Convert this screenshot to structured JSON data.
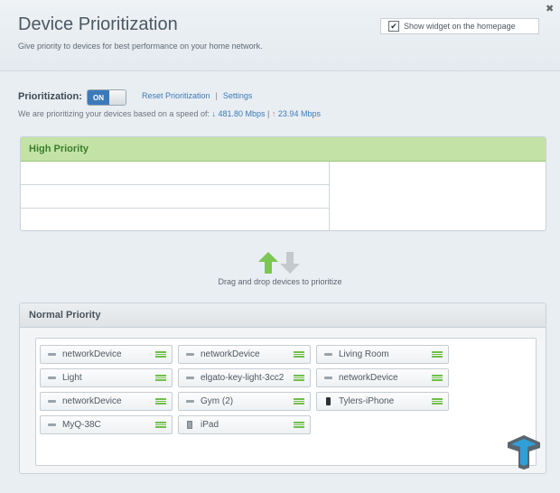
{
  "header": {
    "title": "Device Prioritization",
    "subtitle": "Give priority to devices for best performance on your home network.",
    "show_widget_label": "Show widget on the homepage",
    "show_widget_checked": true,
    "close_icon": "close-icon"
  },
  "prioritization": {
    "label": "Prioritization:",
    "toggle_state": "ON",
    "reset_link": "Reset Prioritization",
    "separator": "|",
    "settings_link": "Settings",
    "speed_text": "We are prioritizing your devices based on a speed of:",
    "download_speed": "481.80 Mbps",
    "speed_separator": "|",
    "upload_speed": "23.94 Mbps"
  },
  "high_priority": {
    "title": "High Priority"
  },
  "drag": {
    "instruction": "Drag and drop devices to prioritize"
  },
  "normal_priority": {
    "title": "Normal Priority",
    "devices": [
      {
        "label": "networkDevice",
        "icon": "router-icon"
      },
      {
        "label": "networkDevice",
        "icon": "router-icon"
      },
      {
        "label": "Living Room",
        "icon": "router-icon"
      },
      {
        "label": "Light",
        "icon": "router-icon"
      },
      {
        "label": "elgato-key-light-3cc2",
        "icon": "router-icon"
      },
      {
        "label": "networkDevice",
        "icon": "router-icon"
      },
      {
        "label": "networkDevice",
        "icon": "router-icon"
      },
      {
        "label": "Gym (2)",
        "icon": "router-icon"
      },
      {
        "label": "Tylers-iPhone",
        "icon": "phone-icon"
      },
      {
        "label": "MyQ-38C",
        "icon": "router-icon"
      },
      {
        "label": "iPad",
        "icon": "tablet-icon"
      }
    ]
  },
  "colors": {
    "accent_blue": "#3c7ab9",
    "high_priority_green": "#c3e3a6",
    "handle_green": "#6fc04b"
  }
}
